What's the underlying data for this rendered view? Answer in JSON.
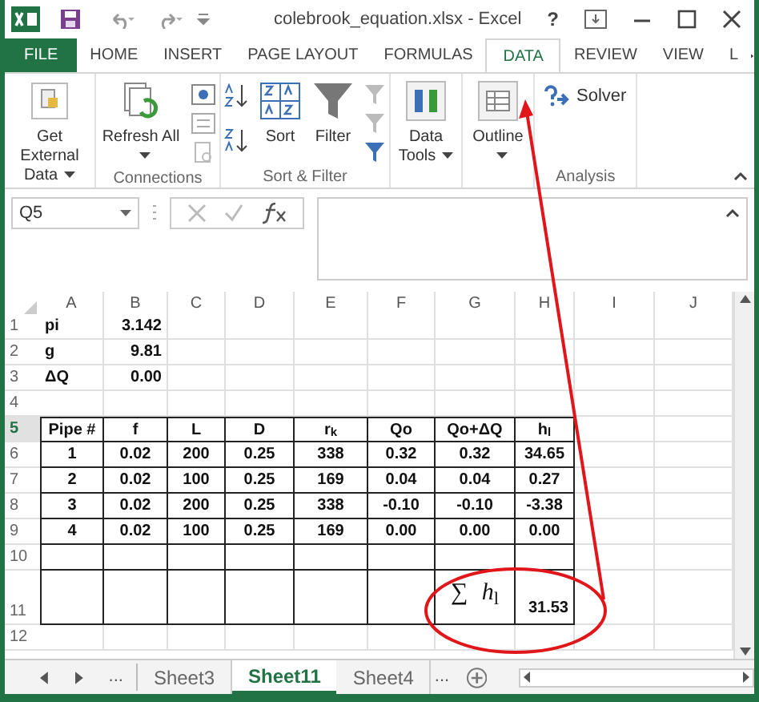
{
  "window": {
    "title": "colebrook_equation.xlsx - Excel",
    "help": "?"
  },
  "file_tab": {
    "label": "FILE"
  },
  "tabs": [
    {
      "label": "HOME",
      "selected": false
    },
    {
      "label": "INSERT",
      "selected": false
    },
    {
      "label": "PAGE LAYOUT",
      "selected": false
    },
    {
      "label": "FORMULAS",
      "selected": false
    },
    {
      "label": "DATA",
      "selected": true
    },
    {
      "label": "REVIEW",
      "selected": false
    },
    {
      "label": "VIEW",
      "selected": false
    },
    {
      "label": "L",
      "selected": false
    }
  ],
  "ribbon": {
    "groups": [
      {
        "buttons": [
          {
            "label": "Get External Data",
            "kind": "external",
            "dropdown": true
          }
        ]
      },
      {
        "label": "Connections",
        "buttons": [
          {
            "label": "Refresh All",
            "kind": "refresh",
            "dropdown": true
          },
          {
            "kind": "small-stack"
          }
        ]
      },
      {
        "label": "Sort & Filter",
        "buttons": [
          {
            "kind": "sort-small"
          },
          {
            "label": "Sort",
            "kind": "sort"
          },
          {
            "label": "Filter",
            "kind": "filter"
          },
          {
            "kind": "filter-small"
          }
        ]
      },
      {
        "buttons": [
          {
            "label": "Data Tools",
            "kind": "tools",
            "dropdown": true
          }
        ]
      },
      {
        "buttons": [
          {
            "label": "Outline",
            "kind": "outline",
            "dropdown": true
          }
        ]
      },
      {
        "label": "Analysis",
        "buttons": [
          {
            "label": "Solver",
            "kind": "solver"
          }
        ]
      }
    ]
  },
  "name_box": {
    "value": "Q5"
  },
  "sheet": {
    "columns": [
      "A",
      "B",
      "C",
      "D",
      "E",
      "F",
      "G",
      "H",
      "I",
      "J"
    ],
    "rows": [
      {
        "label": "1",
        "selected": false,
        "cells": {
          "A": "pi",
          "B": "3.142"
        }
      },
      {
        "label": "2",
        "selected": false,
        "cells": {
          "A": "g",
          "B": "9.81"
        }
      },
      {
        "label": "3",
        "selected": false,
        "cells": {
          "A": "ΔQ",
          "B": "0.00"
        }
      },
      {
        "label": "4",
        "selected": false,
        "cells": {}
      },
      {
        "label": "5",
        "selected": true,
        "boxed": true,
        "cells": {
          "A": "Pipe #",
          "B": "f",
          "C": "L",
          "D": "D",
          "E": "r$_{k}$",
          "F": "Qo",
          "G": "Qo+ΔQ",
          "H": "h$_{l}$"
        }
      },
      {
        "label": "6",
        "selected": false,
        "boxed": true,
        "cells": {
          "A": "1",
          "B": "0.02",
          "C": "200",
          "D": "0.25",
          "E": "338",
          "F": "0.32",
          "G": "0.32",
          "H": "34.65"
        }
      },
      {
        "label": "7",
        "selected": false,
        "boxed": true,
        "cells": {
          "A": "2",
          "B": "0.02",
          "C": "100",
          "D": "0.25",
          "E": "169",
          "F": "0.04",
          "G": "0.04",
          "H": "0.27"
        }
      },
      {
        "label": "8",
        "selected": false,
        "boxed": true,
        "cells": {
          "A": "3",
          "B": "0.02",
          "C": "200",
          "D": "0.25",
          "E": "338",
          "F": "-0.10",
          "G": "-0.10",
          "H": "-3.38"
        }
      },
      {
        "label": "9",
        "selected": false,
        "boxed": true,
        "cells": {
          "A": "4",
          "B": "0.02",
          "C": "100",
          "D": "0.25",
          "E": "169",
          "F": "0.00",
          "G": "0.00",
          "H": "0.00"
        }
      },
      {
        "label": "10",
        "selected": false,
        "boxed": true,
        "cells": {}
      },
      {
        "label": "11",
        "selected": false,
        "boxed": true,
        "kind": "total",
        "cells": {
          "G": "∑ *h*$_{l}$",
          "H": "31.53"
        }
      },
      {
        "label": "12",
        "selected": false,
        "cells": {}
      }
    ]
  },
  "sheet_tabs": {
    "overflow_left": "...",
    "overflow_right": "...",
    "tabs": [
      {
        "label": "Sheet3",
        "selected": false
      },
      {
        "label": "Sheet11",
        "selected": true
      },
      {
        "label": "Sheet4",
        "selected": false
      }
    ]
  }
}
